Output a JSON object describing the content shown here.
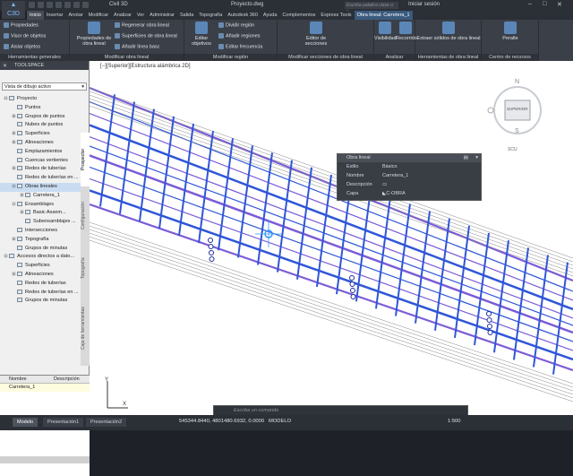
{
  "app": {
    "name": "Civil 3D",
    "file_title": "Proyecto.dwg",
    "search_placeholder": "Escriba palabra clave o frase",
    "user": "Iniciar sesión"
  },
  "menu": [
    "Inicio",
    "Insertar",
    "Anotar",
    "Modificar",
    "Analizar",
    "Ver",
    "Administrar",
    "Salida",
    "Topografía",
    "Autodesk 360",
    "Ayuda",
    "Complementos",
    "Express Tools",
    "Obra lineal:",
    "Carretera_1"
  ],
  "ribbon": {
    "panels": [
      {
        "title": "Herramientas generales",
        "buttons": [
          "Propiedades",
          "Visor de objetos",
          "Aislar objetos"
        ]
      },
      {
        "title": "Modificar obra lineal",
        "buttons": [
          "Propiedades de obra lineal",
          "Regenerar obra lineal",
          "Superficies de obra lineal",
          "Añadir línea basc"
        ]
      },
      {
        "title": "Modificar región",
        "buttons": [
          "Editar objetivos",
          "Dividir región",
          "Añadir regiones",
          "Editar frecuencia"
        ]
      },
      {
        "title": "Modificar secciones de obra lineal",
        "buttons": [
          "Editor de secciones"
        ]
      },
      {
        "title": "Analizar",
        "buttons": [
          "Visibilidad",
          "Recorrido"
        ]
      },
      {
        "title": "Herramientas de obra lineal",
        "buttons": [
          "Extraer sólidos de obra lineal"
        ]
      },
      {
        "title": "Centro de recursos",
        "buttons": [
          "Peralte"
        ]
      }
    ]
  },
  "toolspace": {
    "title": "TOOLSPACE",
    "view_select": "Vista de dibujo activo",
    "tree": [
      {
        "label": "Proyecto",
        "level": 0,
        "toggle": "-"
      },
      {
        "label": "Puntos",
        "level": 1,
        "toggle": ""
      },
      {
        "label": "Grupos de puntos",
        "level": 1,
        "toggle": "+"
      },
      {
        "label": "Nubes de puntos",
        "level": 1,
        "toggle": ""
      },
      {
        "label": "Superficies",
        "level": 1,
        "toggle": "+"
      },
      {
        "label": "Alineaciones",
        "level": 1,
        "toggle": "+"
      },
      {
        "label": "Emplazamientos",
        "level": 1,
        "toggle": ""
      },
      {
        "label": "Cuencas vertientes",
        "level": 1,
        "toggle": ""
      },
      {
        "label": "Redes de tuberías",
        "level": 1,
        "toggle": "+"
      },
      {
        "label": "Redes de tuberías en ...",
        "level": 1,
        "toggle": ""
      },
      {
        "label": "Obras lineales",
        "level": 1,
        "toggle": "-"
      },
      {
        "label": "Carretera_1",
        "level": 2,
        "toggle": "+"
      },
      {
        "label": "Ensamblajes",
        "level": 1,
        "toggle": "-"
      },
      {
        "label": "Basic Assem...",
        "level": 2,
        "toggle": "+"
      },
      {
        "label": "Subensamblajes ...",
        "level": 2,
        "toggle": ""
      },
      {
        "label": "Intersecciones",
        "level": 1,
        "toggle": ""
      },
      {
        "label": "Topografía",
        "level": 1,
        "toggle": "+"
      },
      {
        "label": "Grupos de minutas",
        "level": 1,
        "toggle": ""
      },
      {
        "label": "Accesos directos a dato...",
        "level": 0,
        "toggle": "-"
      },
      {
        "label": "Superficies",
        "level": 1,
        "toggle": ""
      },
      {
        "label": "Alineaciones",
        "level": 1,
        "toggle": "+"
      },
      {
        "label": "Redes de tuberías",
        "level": 1,
        "toggle": ""
      },
      {
        "label": "Redes de tuberías en ...",
        "level": 1,
        "toggle": ""
      },
      {
        "label": "Grupos de minutas",
        "level": 1,
        "toggle": ""
      }
    ],
    "tabs": [
      "Prospector",
      "Configuración",
      "Topografía",
      "Caja de herramientas"
    ],
    "props_headers": [
      "Nombre",
      "Descripción"
    ],
    "props_row": "Carretera_1"
  },
  "viewport": {
    "label": "[−][Superior][Estructura alámbrica 2D]",
    "cube": {
      "n": "N",
      "s": "S",
      "face": "SUPERIOR",
      "wcs": "SCU"
    }
  },
  "tooltip": {
    "title": "Obra lineal",
    "rows": [
      {
        "k": "Estilo",
        "v": "Básico"
      },
      {
        "k": "Nombre",
        "v": "Carretera_1"
      },
      {
        "k": "Descripción",
        "v": ""
      },
      {
        "k": "Capa",
        "v": "C-OBRA"
      }
    ]
  },
  "command_placeholder": "Escriba un comando",
  "status": {
    "tabs": [
      "Modelo",
      "Presentación1",
      "Presentación2"
    ],
    "coords": "545344.8440, 4801480.6932, 0.0000",
    "mode": "MODELO",
    "scale": "1:500"
  },
  "colors": {
    "corridor_blue": "#2f56d8",
    "corridor_purple": "#7b5cd6"
  }
}
